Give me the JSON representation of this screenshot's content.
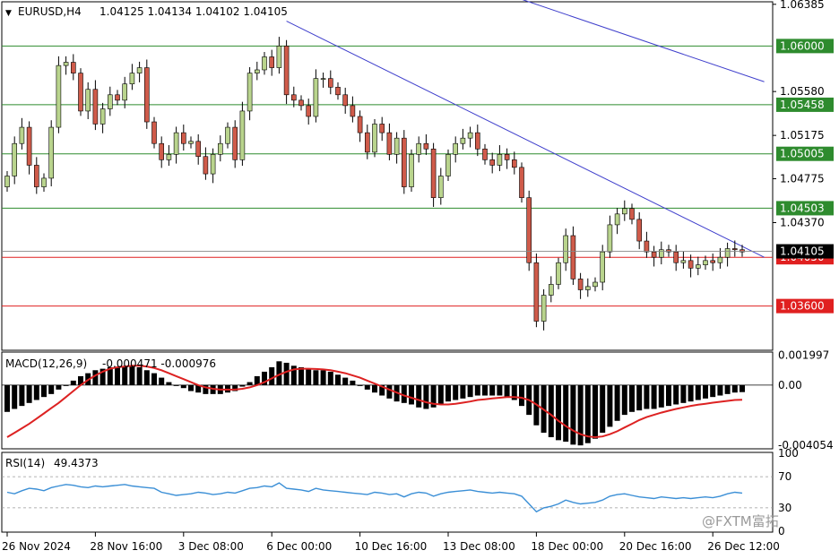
{
  "header": {
    "symbol_tf": "EURUSD,H4",
    "ohlc": "1.04125 1.04134 1.04102 1.04105"
  },
  "watermark": {
    "text": "@FXTM富拓"
  },
  "colors": {
    "bull": "#b9d48d",
    "bear": "#cf5b4a",
    "support_lines": "#2e8b2e",
    "resistance_lines": "#e02020",
    "trendline": "#3f3fcc",
    "macd_hist": "#000000",
    "macd_signal": "#dd2222",
    "rsi": "#3b8fd6",
    "last_price_bg": "#000000"
  },
  "chart_data": [
    {
      "type": "candlestick",
      "panel": "price",
      "ylim": [
        1.032,
        1.064
      ],
      "yticks": [
        "1.06385",
        "1.05580",
        "1.05175",
        "1.04775",
        "1.04370"
      ],
      "xticks": [
        "26 Nov 2024",
        "28 Nov 16:00",
        "3 Dec 08:00",
        "6 Dec 00:00",
        "10 Dec 16:00",
        "13 Dec 08:00",
        "18 Dec 00:00",
        "20 Dec 16:00",
        "26 Dec 12:00"
      ],
      "xtick_index": [
        0,
        12,
        24,
        36,
        48,
        60,
        72,
        84,
        96
      ],
      "levels": [
        {
          "value": 1.06,
          "label": "1.06000",
          "color": "green"
        },
        {
          "value": 1.05458,
          "label": "1.05458",
          "color": "green"
        },
        {
          "value": 1.05005,
          "label": "1.05005",
          "color": "green"
        },
        {
          "value": 1.04503,
          "label": "1.04503",
          "color": "green"
        },
        {
          "value": 1.0405,
          "label": "1.04050",
          "color": "red"
        },
        {
          "value": 1.036,
          "label": "1.03600",
          "color": "red"
        }
      ],
      "last_price": {
        "value": 1.04105,
        "label": "1.04105"
      },
      "trendlines": [
        {
          "from": [
            38,
            1.0623
          ],
          "to": [
            103,
            1.0405
          ]
        },
        {
          "from": [
            67,
            1.065
          ],
          "to": [
            103,
            1.0567
          ]
        }
      ],
      "candles_close": [
        1.048,
        1.051,
        1.0525,
        1.049,
        1.047,
        1.0478,
        1.0525,
        1.0582,
        1.0585,
        1.0575,
        1.054,
        1.056,
        1.0528,
        1.0542,
        1.0555,
        1.055,
        1.0565,
        1.0575,
        1.058,
        1.053,
        1.051,
        1.0495,
        1.05,
        1.052,
        1.051,
        1.0512,
        1.0498,
        1.0482,
        1.05,
        1.051,
        1.0525,
        1.0495,
        1.054,
        1.0575,
        1.0578,
        1.059,
        1.058,
        1.06,
        1.0555,
        1.055,
        1.0545,
        1.0535,
        1.057,
        1.057,
        1.0562,
        1.0555,
        1.0545,
        1.0535,
        1.052,
        1.0502,
        1.0528,
        1.052,
        1.05,
        1.0515,
        1.047,
        1.05,
        1.051,
        1.0505,
        1.046,
        1.048,
        1.05,
        1.051,
        1.0515,
        1.052,
        1.0505,
        1.0495,
        1.049,
        1.05,
        1.0495,
        1.0488,
        1.046,
        1.04,
        1.0346,
        1.037,
        1.038,
        1.04,
        1.0425,
        1.0385,
        1.0375,
        1.0378,
        1.0382,
        1.041,
        1.0435,
        1.0445,
        1.045,
        1.044,
        1.042,
        1.041,
        1.0405,
        1.0412,
        1.041,
        1.04,
        1.0402,
        1.0395,
        1.0398,
        1.0402,
        1.04,
        1.0405,
        1.0413,
        1.0412,
        1.041
      ]
    },
    {
      "type": "histogram+line",
      "panel": "macd",
      "title": "MACD(12,26,9)",
      "values_label": "-0.000471 -0.000976",
      "yticks": [
        "0.001997",
        "0.00",
        "-0.004054"
      ],
      "ylim": [
        -0.00422,
        0.00216
      ],
      "hist": [
        -0.0018,
        -0.0016,
        -0.0014,
        -0.0012,
        -0.001,
        -0.0008,
        -0.0006,
        -0.0003,
        0.0,
        0.0003,
        0.0006,
        0.0008,
        0.001,
        0.0011,
        0.0012,
        0.0012,
        0.0012,
        0.00125,
        0.0012,
        0.001,
        0.0008,
        0.0005,
        0.0002,
        0.0,
        -0.0002,
        -0.0004,
        -0.0005,
        -0.0006,
        -0.0006,
        -0.0006,
        -0.0005,
        -0.0004,
        -0.0001,
        0.0002,
        0.0006,
        0.0009,
        0.0012,
        0.0016,
        0.0015,
        0.0013,
        0.0012,
        0.0011,
        0.001,
        0.001,
        0.0009,
        0.0007,
        0.0005,
        0.0003,
        0.0,
        -0.0003,
        -0.0005,
        -0.0007,
        -0.0009,
        -0.0011,
        -0.0012,
        -0.0013,
        -0.0015,
        -0.0016,
        -0.0015,
        -0.0013,
        -0.0011,
        -0.001,
        -0.0009,
        -0.0008,
        -0.0007,
        -0.0007,
        -0.0007,
        -0.0007,
        -0.0008,
        -0.001,
        -0.0014,
        -0.002,
        -0.0027,
        -0.0032,
        -0.0035,
        -0.0037,
        -0.0038,
        -0.004,
        -0.00405,
        -0.0039,
        -0.0036,
        -0.0032,
        -0.0028,
        -0.0024,
        -0.002,
        -0.0018,
        -0.0017,
        -0.0016,
        -0.0016,
        -0.0015,
        -0.0014,
        -0.0013,
        -0.0012,
        -0.0011,
        -0.001,
        -0.0009,
        -0.0008,
        -0.0007,
        -0.0006,
        -0.0005,
        -0.00047
      ],
      "signal": [
        -0.0035,
        -0.0032,
        -0.0029,
        -0.0026,
        -0.00225,
        -0.0019,
        -0.00155,
        -0.0012,
        -0.0008,
        -0.0004,
        0.0,
        0.00035,
        0.00065,
        0.0009,
        0.0011,
        0.0012,
        0.00125,
        0.0013,
        0.0013,
        0.00125,
        0.00115,
        0.001,
        0.0008,
        0.0006,
        0.0004,
        0.0002,
        0.0,
        -0.00015,
        -0.00025,
        -0.0003,
        -0.0003,
        -0.0003,
        -0.00025,
        -0.00015,
        0.0,
        0.0002,
        0.00045,
        0.0007,
        0.0009,
        0.00105,
        0.0011,
        0.0011,
        0.00108,
        0.00105,
        0.001,
        0.0009,
        0.0008,
        0.00065,
        0.0005,
        0.0003,
        0.0001,
        -0.0001,
        -0.0003,
        -0.0005,
        -0.0007,
        -0.00085,
        -0.001,
        -0.00115,
        -0.00125,
        -0.0013,
        -0.0013,
        -0.00125,
        -0.00118,
        -0.0011,
        -0.001,
        -0.00095,
        -0.0009,
        -0.00085,
        -0.0008,
        -0.0008,
        -0.00085,
        -0.001,
        -0.0013,
        -0.00165,
        -0.002,
        -0.0024,
        -0.00275,
        -0.00305,
        -0.0033,
        -0.00345,
        -0.0035,
        -0.00345,
        -0.0033,
        -0.0031,
        -0.00285,
        -0.0026,
        -0.00235,
        -0.00215,
        -0.002,
        -0.00185,
        -0.00172,
        -0.0016,
        -0.0015,
        -0.0014,
        -0.00132,
        -0.00125,
        -0.00118,
        -0.00112,
        -0.00106,
        -0.001,
        -0.00098
      ]
    },
    {
      "type": "line",
      "panel": "rsi",
      "title": "RSI(14)",
      "value_label": "49.4373",
      "yticks": [
        "100",
        "70",
        "30",
        "0"
      ],
      "ylim": [
        0,
        100
      ],
      "levels": [
        70,
        30
      ],
      "values": [
        50,
        48,
        52,
        55,
        54,
        52,
        56,
        58,
        60,
        59,
        57,
        56,
        58,
        57,
        58,
        59,
        60,
        58,
        57,
        56,
        55,
        50,
        48,
        46,
        47,
        48,
        50,
        49,
        47,
        48,
        50,
        49,
        52,
        55,
        56,
        58,
        57,
        62,
        55,
        54,
        53,
        51,
        55,
        53,
        52,
        51,
        50,
        49,
        48,
        47,
        50,
        49,
        47,
        48,
        44,
        48,
        50,
        49,
        45,
        48,
        50,
        51,
        52,
        53,
        51,
        50,
        49,
        50,
        49,
        48,
        45,
        35,
        25,
        30,
        32,
        35,
        40,
        37,
        35,
        36,
        37,
        40,
        45,
        47,
        48,
        46,
        44,
        43,
        42,
        44,
        43,
        42,
        43,
        42,
        43,
        44,
        43,
        45,
        48,
        50,
        49
      ]
    }
  ]
}
